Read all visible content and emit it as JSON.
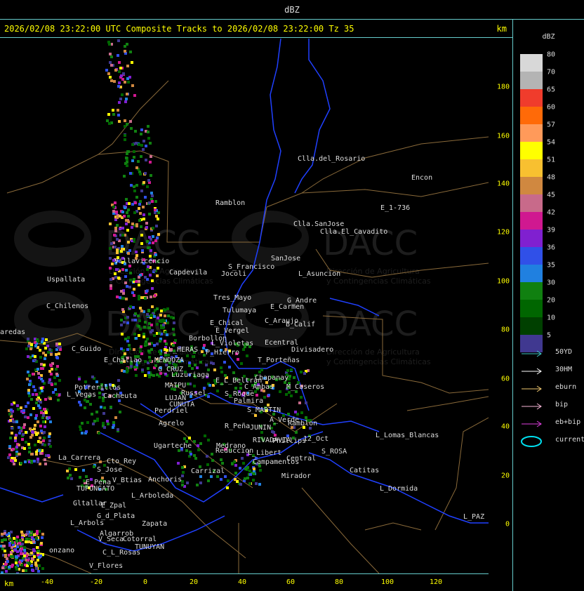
{
  "header": {
    "title": "dBZ"
  },
  "map_title": "2026/02/08 23:22:00 UTC Composite Tracks to 2026/02/08 23:22:00 Tz 35",
  "units": "km",
  "watermark": {
    "name": "DACC",
    "line1": "Dirección de Agricultura",
    "line2": "y Contingencias Climáticas"
  },
  "y_axis": {
    "label": "km",
    "ticks": [
      "180",
      "160",
      "140",
      "120",
      "100",
      "80",
      "60",
      "40",
      "20",
      "0"
    ]
  },
  "x_axis": {
    "label": "km",
    "ticks": [
      "-40",
      "-20",
      "0",
      "20",
      "40",
      "60",
      "80",
      "100",
      "120"
    ]
  },
  "legend": {
    "title": "dBZ",
    "levels": [
      {
        "label": "80",
        "color": "#d8d8d8"
      },
      {
        "label": "70",
        "color": "#b4b4b4"
      },
      {
        "label": "65",
        "color": "#f03c2c"
      },
      {
        "label": "60",
        "color": "#ff6a08"
      },
      {
        "label": "57",
        "color": "#ff9a5a"
      },
      {
        "label": "54",
        "color": "#ffff00"
      },
      {
        "label": "51",
        "color": "#f8c030"
      },
      {
        "label": "48",
        "color": "#d08840"
      },
      {
        "label": "45",
        "color": "#c86a8a"
      },
      {
        "label": "42",
        "color": "#d01890"
      },
      {
        "label": "39",
        "color": "#8020d0"
      },
      {
        "label": "36",
        "color": "#3050e8"
      },
      {
        "label": "35",
        "color": "#2080e0"
      },
      {
        "label": "30",
        "color": "#108010"
      },
      {
        "label": "20",
        "color": "#006600"
      },
      {
        "label": "10",
        "color": "#004000"
      },
      {
        "label": "5",
        "color": "#403890"
      }
    ],
    "tracks": [
      {
        "label": "50YD",
        "color": "#40c8c8"
      },
      {
        "label": "30HM",
        "color": "#ffffff"
      },
      {
        "label": "eburn",
        "color": "#f0c870"
      },
      {
        "label": "bip",
        "color": "#f8b8d8"
      },
      {
        "label": "eb+bip",
        "color": "#e040e0"
      },
      {
        "label": "current",
        "color": "#00e0f0"
      }
    ]
  },
  "places": [
    "Clla.del_Rosario",
    "Encon",
    "E_1-736",
    "Ramblon",
    "Clla.SanJose",
    "Clla.El_Cavadito",
    "Uspallata",
    "Villavicencio",
    "Capdevila",
    "S_Francisco",
    "SanJose",
    "L_Asuncion",
    "Jocoli",
    "Tres_Mayo",
    "G_Andre",
    "E_Carmen",
    "C_Chilenos",
    "Tulumaya",
    "E_Chical",
    "C_Araujo",
    "B_Calif",
    "E_Vergel",
    "Borbollon",
    "Ecentral",
    "Divisadero",
    "aredas",
    "L_Violetas",
    "C_Guido",
    "L_HERAS",
    "P_Hierro",
    "T_Porteñas",
    "E_Challao",
    "MENDOZA",
    "G_CRUZ",
    "Luzuriaga",
    "Chapanay",
    "E_L_Beltran",
    "C_Ambas",
    "M_Caseros",
    "Potrerillos",
    "MAIPU",
    "Russel",
    "L_Vegas",
    "Cacheuta",
    "S_Roque",
    "Palmira",
    "LUJAN",
    "CUNUTA",
    "S_MARTIN",
    "Perdriel",
    "A_Verde",
    "Agrelo",
    "R_Peña",
    "JUNIN",
    "Ramblon",
    "L_Lomas_Blancas",
    "Ugarteche",
    "RIVADAVIA",
    "Medrano",
    "Phillips",
    "12_Oct",
    "Reduccion",
    "L_Libert",
    "S_ROSA",
    "La_Carrera",
    "Cto_Rey",
    "Campamentos",
    "Central",
    "Catitas",
    "S_Jose",
    "Carrizal",
    "Anchoris",
    "Mirador",
    "E_Pena",
    "V_Btias",
    "TUPUNGATO",
    "L_Dormida",
    "L_Arboleda",
    "E_Zpal",
    "Gltallar",
    "G_d_Plata",
    "L_PAZ",
    "L_Arbols",
    "Zapata",
    "Algarrob",
    "V_Seca",
    "Cotorral",
    "TUNUYAN",
    "onzano",
    "C_L_Rosas",
    "V_Flores"
  ]
}
